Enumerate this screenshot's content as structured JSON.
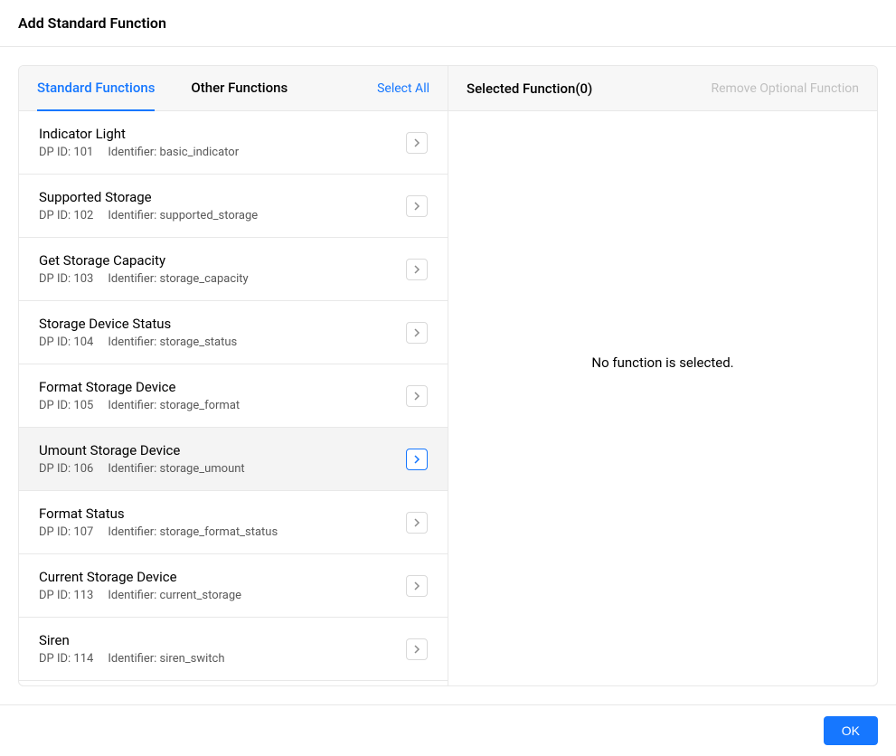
{
  "dialog": {
    "title": "Add Standard Function",
    "ok_label": "OK"
  },
  "tabs": {
    "standard": "Standard Functions",
    "other": "Other Functions",
    "select_all": "Select All"
  },
  "selected_panel": {
    "title": "Selected Function(0)",
    "remove_label": "Remove Optional Function",
    "empty_message": "No function is selected."
  },
  "meta_labels": {
    "dp_id_prefix": "DP ID: ",
    "identifier_prefix": "Identifier: "
  },
  "functions": [
    {
      "name": "Indicator Light",
      "dp_id": "101",
      "identifier": "basic_indicator",
      "highlighted": false
    },
    {
      "name": "Supported Storage",
      "dp_id": "102",
      "identifier": "supported_storage",
      "highlighted": false
    },
    {
      "name": "Get Storage Capacity",
      "dp_id": "103",
      "identifier": "storage_capacity",
      "highlighted": false
    },
    {
      "name": "Storage Device Status",
      "dp_id": "104",
      "identifier": "storage_status",
      "highlighted": false
    },
    {
      "name": "Format Storage Device",
      "dp_id": "105",
      "identifier": "storage_format",
      "highlighted": false
    },
    {
      "name": "Umount Storage Device",
      "dp_id": "106",
      "identifier": "storage_umount",
      "highlighted": true
    },
    {
      "name": "Format Status",
      "dp_id": "107",
      "identifier": "storage_format_status",
      "highlighted": false
    },
    {
      "name": "Current Storage Device",
      "dp_id": "113",
      "identifier": "current_storage",
      "highlighted": false
    },
    {
      "name": "Siren",
      "dp_id": "114",
      "identifier": "siren_switch",
      "highlighted": false
    }
  ]
}
